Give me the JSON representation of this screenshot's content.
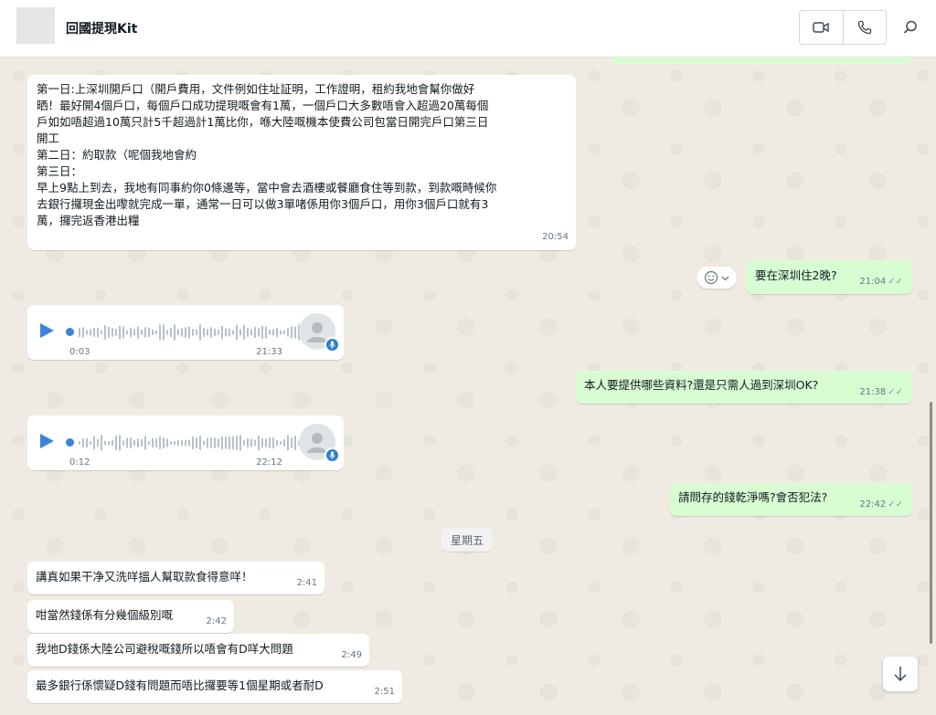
{
  "header": {
    "contact_name": "回國提現Kit",
    "video_call_icon": "video-camera-icon",
    "voice_call_icon": "phone-icon",
    "search_icon": "search-icon"
  },
  "messages": {
    "m1": {
      "text": "第一日:上深圳開戶口（開戶費用，文件例如住址証明，工作證明，租約我地會幫你做好\n晒！最好開4個戶口，每個戶口成功提現嘅會有1萬，一個戶口大多數唔會入超過20萬每個\n戶如如唔超過10萬只計5千超過計1萬比你，喺大陸嘅機本使費公司包當日開完戶口第三日\n開工\n第二日：約取款（呢個我地會約\n第三日：\n早上9點上到去，我地有同事約你0條邊等，當中會去酒樓或餐廳食住等到款，到款嘅時候你\n去銀行攞現金出嚟就完成一單，通常一日可以做3單啫係用你3個戶口，用你3個戶口就有3\n萬，攞完返香港出糧",
      "time": "20:54"
    },
    "m2": {
      "text": "要在深圳住2晚?",
      "time": "21:04",
      "ticks": "✓✓"
    },
    "v1": {
      "duration": "0:03",
      "time": "21:33"
    },
    "v2": {
      "duration": "0:12",
      "time": "22:12"
    },
    "m3": {
      "text": "本人要提供哪些資料?還是只需人過到深圳OK?",
      "time": "21:38",
      "ticks": "✓✓"
    },
    "m4": {
      "text": "請問存的錢乾淨嗎?會否犯法?",
      "time": "22:42",
      "ticks": "✓✓"
    },
    "day_divider": "星期五",
    "m5": {
      "text": "講真如果干净又洗咩搵人幫取款食得意咩！",
      "time": "2:41"
    },
    "m6": {
      "text": "咁當然錢係有分幾個級別嘅",
      "time": "2:42"
    },
    "m7": {
      "text": "我地D錢係大陸公司避稅嘅錢所以唔會有D咩大問題",
      "time": "2:49"
    },
    "m8": {
      "text": "最多銀行係懷疑D錢有問題而唔比攞要等1個星期或者耐D",
      "time": "2:51"
    }
  },
  "colors": {
    "incoming": "#ffffff",
    "outgoing": "#d9fdd3",
    "accent_blue": "#3b84d8",
    "chat_bg": "#efeae2"
  }
}
